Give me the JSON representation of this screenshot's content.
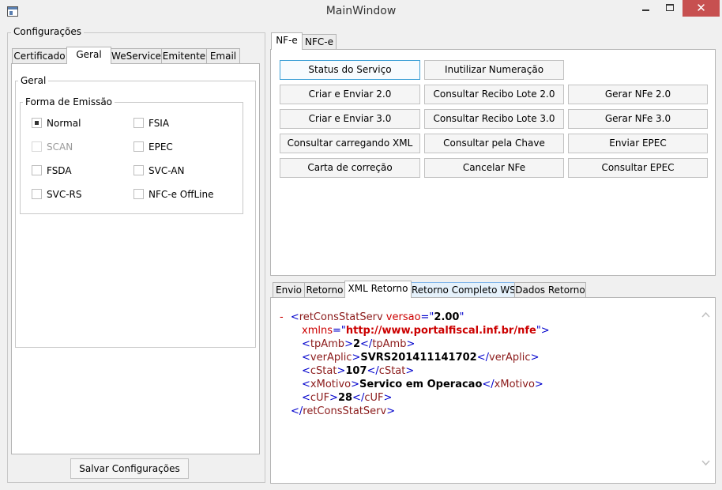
{
  "window": {
    "title": "MainWindow",
    "close_glyph": "✕"
  },
  "config": {
    "group_title": "Configurações",
    "tabs": [
      "Certificado",
      "Geral",
      "WeService",
      "Emitente",
      "Email"
    ],
    "geral_group": "Geral",
    "forma_group": "Forma de Emissão",
    "options": [
      {
        "label": "Normal",
        "checked": true,
        "enabled": true
      },
      {
        "label": "FSIA",
        "checked": false,
        "enabled": true
      },
      {
        "label": "SCAN",
        "checked": false,
        "enabled": false
      },
      {
        "label": "EPEC",
        "checked": false,
        "enabled": true
      },
      {
        "label": "FSDA",
        "checked": false,
        "enabled": true
      },
      {
        "label": "SVC-AN",
        "checked": false,
        "enabled": true
      },
      {
        "label": "SVC-RS",
        "checked": false,
        "enabled": true
      },
      {
        "label": "NFC-e OffLine",
        "checked": false,
        "enabled": true
      }
    ],
    "save_label": "Salvar Configurações"
  },
  "service": {
    "tabs": [
      "NF-e",
      "NFC-e"
    ],
    "buttons": [
      [
        "Status do Serviço",
        "Inutilizar Numeração",
        ""
      ],
      [
        "Criar e Enviar 2.0",
        "Consultar Recibo Lote 2.0",
        "Gerar NFe 2.0"
      ],
      [
        "Criar e Enviar 3.0",
        "Consultar Recibo Lote 3.0",
        "Gerar NFe 3.0"
      ],
      [
        "Consultar carregando XML",
        "Consultar pela Chave",
        "Enviar EPEC"
      ],
      [
        "Carta de correção",
        "Cancelar NFe",
        "Consultar EPEC"
      ]
    ]
  },
  "result": {
    "tabs": [
      "Envio",
      "Retorno",
      "XML Retorno",
      "Retorno Completo WS",
      "Dados Retorno"
    ],
    "xml": {
      "minus": "-",
      "open_lt": "<",
      "gt": ">",
      "close_lt": "</",
      "eq_q": "=\"",
      "q": "\"",
      "root": "retConsStatServ",
      "attr_versao": "versao",
      "versao": "2.00",
      "attr_xmlns": "xmlns",
      "xmlns": "http://www.portalfiscal.inf.br/nfe",
      "elements": [
        {
          "tag": "tpAmb",
          "value": "2"
        },
        {
          "tag": "verAplic",
          "value": "SVRS201411141702"
        },
        {
          "tag": "cStat",
          "value": "107"
        },
        {
          "tag": "xMotivo",
          "value": "Servico em Operacao"
        },
        {
          "tag": "cUF",
          "value": "28"
        }
      ]
    }
  }
}
